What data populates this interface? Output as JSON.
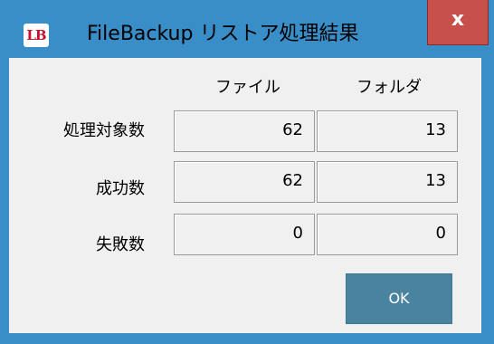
{
  "window": {
    "title": "FileBackup リストア処理結果",
    "icon_text": "LB",
    "close_glyph": "x"
  },
  "table": {
    "columns": [
      "ファイル",
      "フォルダ"
    ],
    "rows": [
      {
        "label": "処理対象数",
        "file": "62",
        "folder": "13"
      },
      {
        "label": "成功数",
        "file": "62",
        "folder": "13"
      },
      {
        "label": "失敗数",
        "file": "0",
        "folder": "0"
      }
    ]
  },
  "buttons": {
    "ok_label": "OK"
  },
  "colors": {
    "frame": "#3a8ec7",
    "close_button": "#c7504a",
    "ok_button": "#4a83a0",
    "client_bg": "#f0f0f0"
  },
  "icons": {
    "app": "lb-app-icon",
    "close": "close-icon"
  }
}
